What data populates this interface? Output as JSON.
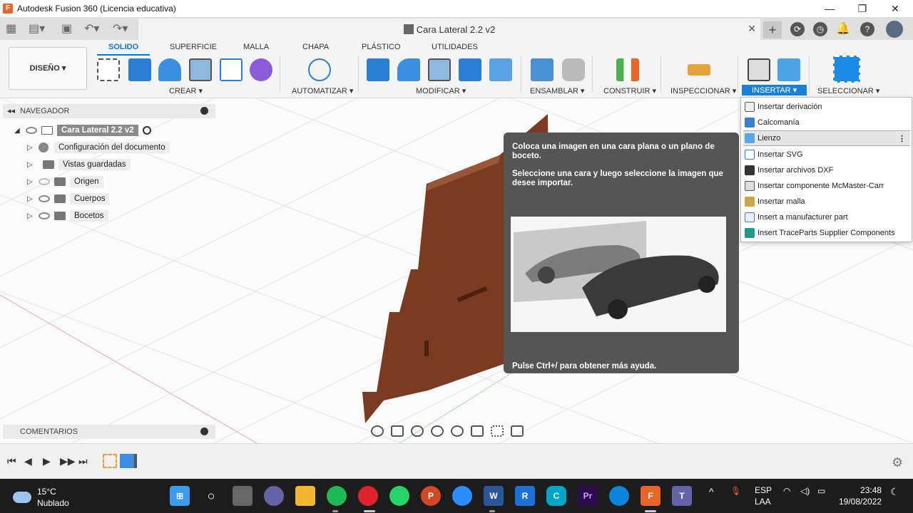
{
  "window": {
    "title": "Autodesk Fusion 360 (Licencia educativa)",
    "minimize": "—",
    "maximize": "❐",
    "close": "✕"
  },
  "document": {
    "tab_title": "Cara Lateral 2.2 v2",
    "close": "✕",
    "new_tab": "+"
  },
  "ribbon": {
    "workspace": "DISEÑO ▾",
    "tabs": [
      "SOLIDO",
      "SUPERFICIE",
      "MALLA",
      "CHAPA",
      "PLÁSTICO",
      "UTILIDADES"
    ],
    "active_tab": "SOLIDO",
    "groups": [
      "CREAR ▾",
      "AUTOMATIZAR ▾",
      "MODIFICAR ▾",
      "ENSAMBLAR ▾",
      "CONSTRUIR ▾",
      "INSPECCIONAR ▾",
      "INSERTAR ▾",
      "SELECCIONAR ▾"
    ],
    "active_group": "INSERTAR ▾"
  },
  "browser": {
    "title": "NAVEGADOR",
    "collapse": "◂◂",
    "root": "Cara Lateral 2.2 v2",
    "items": [
      "Configuración del documento",
      "Vistas guardadas",
      "Origen",
      "Cuerpos",
      "Bocetos"
    ]
  },
  "comments": {
    "title": "COMENTARIOS"
  },
  "tooltip": {
    "line1": "Coloca una imagen en una cara plana o un plano de boceto.",
    "line2": "Seleccione una cara y luego seleccione la imagen que desee importar.",
    "help": "Pulse Ctrl+/ para obtener más ayuda."
  },
  "insert_menu": {
    "items": [
      "Insertar derivación",
      "Calcomanía",
      "Lienzo",
      "Insertar SVG",
      "Insertar archivos DXF",
      "Insertar componente McMaster-Carr",
      "Insertar malla",
      "Insert a manufacturer part",
      "Insert TraceParts Supplier Components"
    ],
    "highlighted": "Lienzo",
    "more": "⋮"
  },
  "timeline": {
    "buttons": [
      "⏮",
      "◀",
      "▶",
      "▶▶",
      "⏭"
    ]
  },
  "taskbar": {
    "weather_temp": "15°C",
    "weather_desc": "Nublado",
    "language": "ESP",
    "layout": "LAA",
    "time": "23:48",
    "date": "19/08/2022"
  },
  "colors": {
    "accent": "#0a78d1",
    "wood": "#7a3b22",
    "tooltip_bg": "#555555",
    "taskbar_bg": "#1c1c1c"
  }
}
